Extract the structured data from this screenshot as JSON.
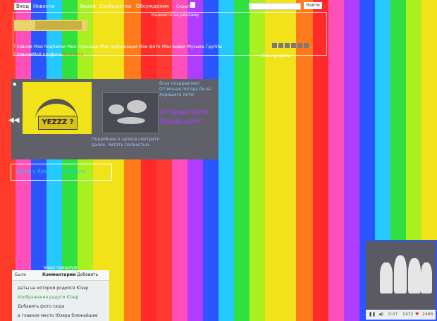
{
  "colors": {
    "stripes": [
      "#ff3a28",
      "#ff4fb8",
      "#2a55ff",
      "#25c9ff",
      "#30e040",
      "#a8f020",
      "#f2e21a",
      "#ff7a1a",
      "#b03cff"
    ]
  },
  "nav": {
    "tabs": [
      "Вход",
      "Новости",
      "",
      "",
      "Видео",
      "",
      "Сообщества",
      "Обсуждения",
      "Посты"
    ],
    "small_link": "Скрыть"
  },
  "search": {
    "placeholder": "",
    "button": "Найти"
  },
  "header": {
    "topline": "Нажмите на рекламу"
  },
  "breadcrumb": {
    "items": [
      "Главная",
      "Мои подписки",
      "Моя страница",
      "Мои публикации",
      "Мои фото",
      "Мои видео",
      "Музыка",
      "Группы"
    ]
  },
  "subnav": {
    "left": "Главная",
    "mid": "Мой профиль",
    "badge": "Написать",
    "right": "Мой профиль"
  },
  "feature": {
    "caption": "YEZZZ ?",
    "text": "Всех поздравляю! Отличная погода была! Хорошего лета!",
    "title": "Отправляйте Яркий цвет",
    "sub": "Подробнее о записи смотрите далее. Читать полностью."
  },
  "link_box": {
    "label": "связи с Яркостью Чигаз.ru"
  },
  "panel": {
    "above": "вашу прошлую",
    "header_left": "Было",
    "header_mid": "Комментарии",
    "header_right": "Добавить",
    "rows": [
      "даты на которой родился Юзер",
      "Изображение радуги Юзер",
      "Добавить фото сюда",
      "а главное место Юзера ближайшее"
    ]
  },
  "video": {
    "time": "0:07",
    "likes": "1472",
    "count": "2466"
  }
}
